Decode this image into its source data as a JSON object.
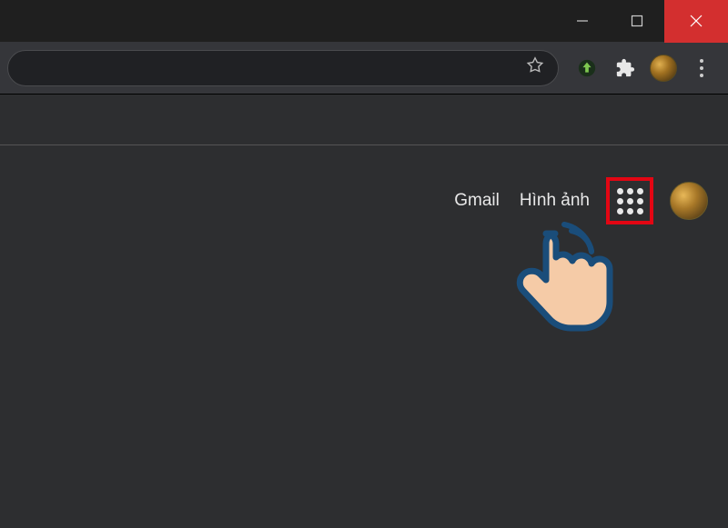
{
  "window_controls": {
    "minimize": "minimize",
    "maximize": "maximize",
    "close": "close"
  },
  "toolbar": {
    "bookmark": "bookmark-star",
    "idm_ext": "idm",
    "extensions": "extensions",
    "profile": "profile",
    "menu": "menu"
  },
  "page_header": {
    "gmail_label": "Gmail",
    "images_label": "Hình ảnh"
  },
  "annotation": {
    "highlight_target": "apps-grid-button"
  }
}
